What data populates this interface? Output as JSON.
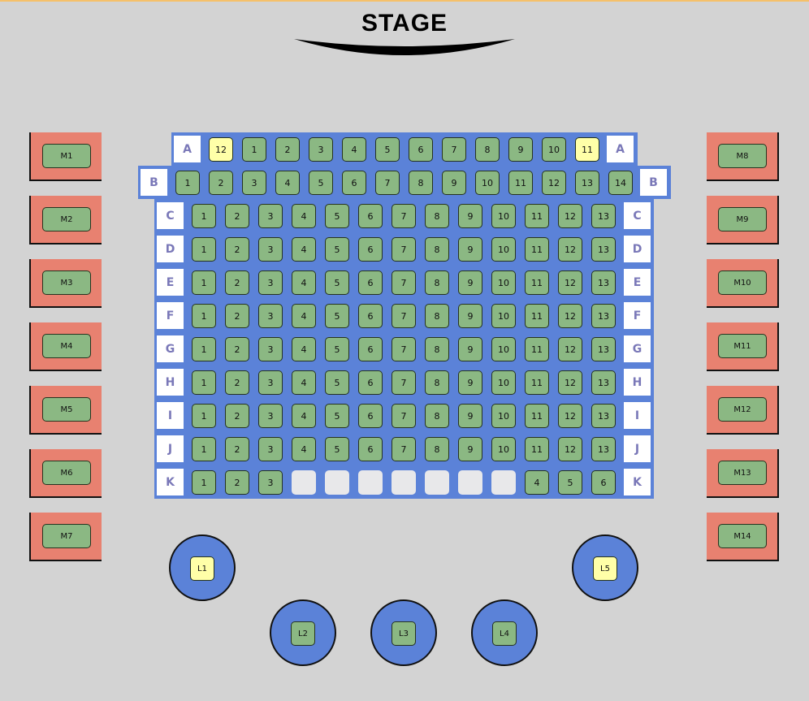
{
  "stage": {
    "label": "STAGE"
  },
  "colors": {
    "background": "#d3d3d3",
    "block": "#5b82d8",
    "available": "#8bb883",
    "highlighted": "#ffffa8",
    "empty": "#e8e8ea",
    "box": "#e88170",
    "row_label_text": "#7a78b8"
  },
  "rows": [
    {
      "letter": "A",
      "seats": [
        "12",
        "1",
        "2",
        "3",
        "4",
        "5",
        "6",
        "7",
        "8",
        "9",
        "10",
        "11"
      ],
      "highlighted": [
        "12",
        "11"
      ]
    },
    {
      "letter": "B",
      "seats": [
        "1",
        "2",
        "3",
        "4",
        "5",
        "6",
        "7",
        "8",
        "9",
        "10",
        "11",
        "12",
        "13",
        "14"
      ],
      "highlighted": []
    },
    {
      "letter": "C",
      "seats": [
        "1",
        "2",
        "3",
        "4",
        "5",
        "6",
        "7",
        "8",
        "9",
        "10",
        "11",
        "12",
        "13"
      ],
      "highlighted": []
    },
    {
      "letter": "D",
      "seats": [
        "1",
        "2",
        "3",
        "4",
        "5",
        "6",
        "7",
        "8",
        "9",
        "10",
        "11",
        "12",
        "13"
      ],
      "highlighted": []
    },
    {
      "letter": "E",
      "seats": [
        "1",
        "2",
        "3",
        "4",
        "5",
        "6",
        "7",
        "8",
        "9",
        "10",
        "11",
        "12",
        "13"
      ],
      "highlighted": []
    },
    {
      "letter": "F",
      "seats": [
        "1",
        "2",
        "3",
        "4",
        "5",
        "6",
        "7",
        "8",
        "9",
        "10",
        "11",
        "12",
        "13"
      ],
      "highlighted": []
    },
    {
      "letter": "G",
      "seats": [
        "1",
        "2",
        "3",
        "4",
        "5",
        "6",
        "7",
        "8",
        "9",
        "10",
        "11",
        "12",
        "13"
      ],
      "highlighted": []
    },
    {
      "letter": "H",
      "seats": [
        "1",
        "2",
        "3",
        "4",
        "5",
        "6",
        "7",
        "8",
        "9",
        "10",
        "11",
        "12",
        "13"
      ],
      "highlighted": []
    },
    {
      "letter": "I",
      "seats": [
        "1",
        "2",
        "3",
        "4",
        "5",
        "6",
        "7",
        "8",
        "9",
        "10",
        "11",
        "12",
        "13"
      ],
      "highlighted": []
    },
    {
      "letter": "J",
      "seats": [
        "1",
        "2",
        "3",
        "4",
        "5",
        "6",
        "7",
        "8",
        "9",
        "10",
        "11",
        "12",
        "13"
      ],
      "highlighted": []
    },
    {
      "letter": "K",
      "seats": [
        "1",
        "2",
        "3",
        "",
        "",
        "",
        "",
        "",
        "",
        "",
        "4",
        "5",
        "6"
      ],
      "highlighted": []
    }
  ],
  "boxes_left": [
    "M1",
    "M2",
    "M3",
    "M4",
    "M5",
    "M6",
    "M7"
  ],
  "boxes_right": [
    "M8",
    "M9",
    "M10",
    "M11",
    "M12",
    "M13",
    "M14"
  ],
  "lodges": [
    {
      "label": "L1",
      "highlighted": true
    },
    {
      "label": "L2",
      "highlighted": false
    },
    {
      "label": "L3",
      "highlighted": false
    },
    {
      "label": "L4",
      "highlighted": false
    },
    {
      "label": "L5",
      "highlighted": true
    }
  ]
}
